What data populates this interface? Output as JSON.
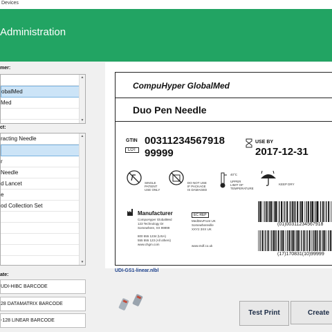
{
  "window": {
    "title": "Devices"
  },
  "header": {
    "title": "Administration"
  },
  "customer": {
    "label": "mer:",
    "items": [
      "",
      "obalMed",
      "Med",
      "",
      ""
    ],
    "selected_index": 1
  },
  "product": {
    "label": "ct:",
    "items": [
      "racting Needle",
      "",
      "r",
      "Needle",
      "d Lancet",
      "e",
      "od Collection Set",
      "",
      "",
      "",
      ""
    ],
    "selected_index": 1
  },
  "template": {
    "label": "ate:",
    "buttons": [
      "UDI-HIBC BARCODE",
      "28 DATAMATRIX BARCODE",
      "-128 LINEAR BARCODE"
    ]
  },
  "preview": {
    "company": "CompuHyper GlobalMed",
    "product_name": "Duo Pen Needle",
    "gtin_tag": "GTIN",
    "gtin": "00311234567918",
    "lot_tag": "LOT",
    "lot": "99999",
    "use_by_tag": "USE BY",
    "use_by": "2017-12-31",
    "symbols": {
      "single_use": "SINGLE\nPATIENT\nUSE ONLY",
      "damaged": "DO NOT USE\nIF PACKAGE\nIS DAMAGED",
      "temp_value": "40°C",
      "temp": "UPPER\nLIMIT OF\nTEMPERATURE",
      "dry": "KEEP DRY"
    },
    "manufacturer_title": "Manufacturer",
    "manufacturer_lines": [
      "CompuHyper GlobalMed",
      "123 Technology Dr",
      "Somewhere, XX 99999",
      "",
      "800 555 1234 (USA)",
      "555 555 123 (All others)",
      "www.chgm.com"
    ],
    "ec_rep": "EC  REP",
    "rep_lines": [
      "MedDevFront UK",
      "Somewhereville",
      "XXY2 3XX UK",
      "",
      "",
      "",
      "www.mdf.co.uk"
    ],
    "barcode1_text": "(01)00311234567918",
    "barcode2_text": "(17)170831(10)99999"
  },
  "file_name": "UDI-GS1-linear.nlbl",
  "actions": {
    "test_print": "Test Print",
    "create": "Create"
  }
}
